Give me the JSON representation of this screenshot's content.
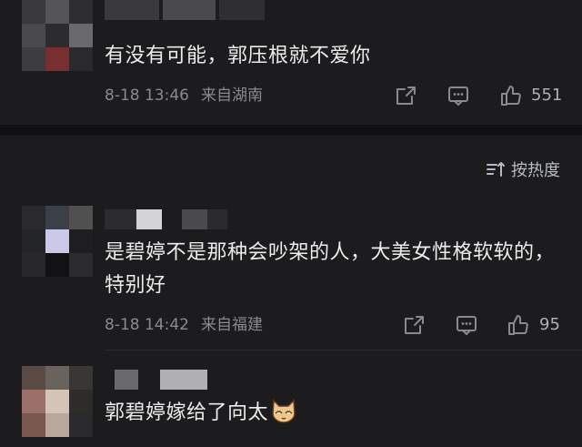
{
  "comments": [
    {
      "text": "有没有可能，郭压根就不爱你",
      "time": "8-18 13:46",
      "location": "来自湖南",
      "likes": "551"
    },
    {
      "text": "是碧婷不是那种会吵架的人，大美女性格软软的，特别好",
      "time": "8-18 14:42",
      "location": "来自福建",
      "likes": "95"
    },
    {
      "text": "郭碧婷嫁给了向太",
      "emoji": "cat-face-emoji"
    }
  ],
  "sort": {
    "label": "按热度",
    "icon": "sort-icon"
  },
  "icons": {
    "share": "share-icon",
    "comment": "comment-icon",
    "like": "thumbs-up-icon"
  },
  "colors": {
    "background": "#1c1c1e",
    "divider": "#111113",
    "text": "#ececec",
    "meta": "#8a8a8e",
    "sort": "#b6bac4"
  }
}
